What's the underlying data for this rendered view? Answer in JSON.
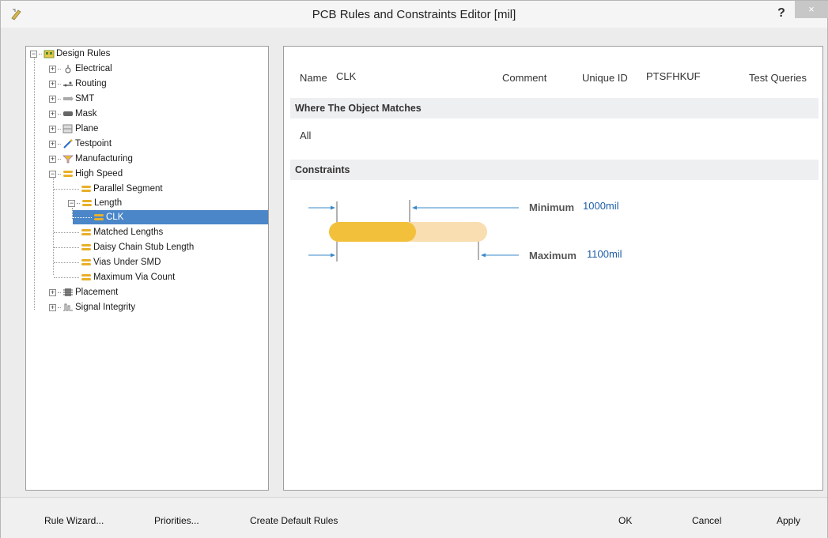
{
  "window": {
    "title": "PCB Rules and Constraints Editor [mil]",
    "help": "?",
    "close": "×"
  },
  "tree": {
    "root": "Design Rules",
    "items": [
      {
        "label": "Electrical"
      },
      {
        "label": "Routing"
      },
      {
        "label": "SMT"
      },
      {
        "label": "Mask"
      },
      {
        "label": "Plane"
      },
      {
        "label": "Testpoint"
      },
      {
        "label": "Manufacturing"
      },
      {
        "label": "High Speed"
      },
      {
        "label": "Parallel Segment"
      },
      {
        "label": "Length"
      },
      {
        "label": "CLK"
      },
      {
        "label": "Matched Lengths"
      },
      {
        "label": "Daisy Chain Stub Length"
      },
      {
        "label": "Vias Under SMD"
      },
      {
        "label": "Maximum Via Count"
      },
      {
        "label": "Placement"
      },
      {
        "label": "Signal Integrity"
      }
    ]
  },
  "rule": {
    "name_label": "Name",
    "name_value": "CLK",
    "comment_label": "Comment",
    "uniqueid_label": "Unique ID",
    "uniqueid_value": "PTSFHKUF",
    "test_queries": "Test Queries"
  },
  "where": {
    "header": "Where The Object Matches",
    "value": "All"
  },
  "constraints": {
    "header": "Constraints",
    "minimum_label": "Minimum",
    "minimum_value": "1000mil",
    "maximum_label": "Maximum",
    "maximum_value": "1100mil"
  },
  "buttons": {
    "rule_wizard": "Rule Wizard...",
    "priorities": "Priorities...",
    "create_default": "Create Default Rules",
    "ok": "OK",
    "cancel": "Cancel",
    "apply": "Apply"
  }
}
